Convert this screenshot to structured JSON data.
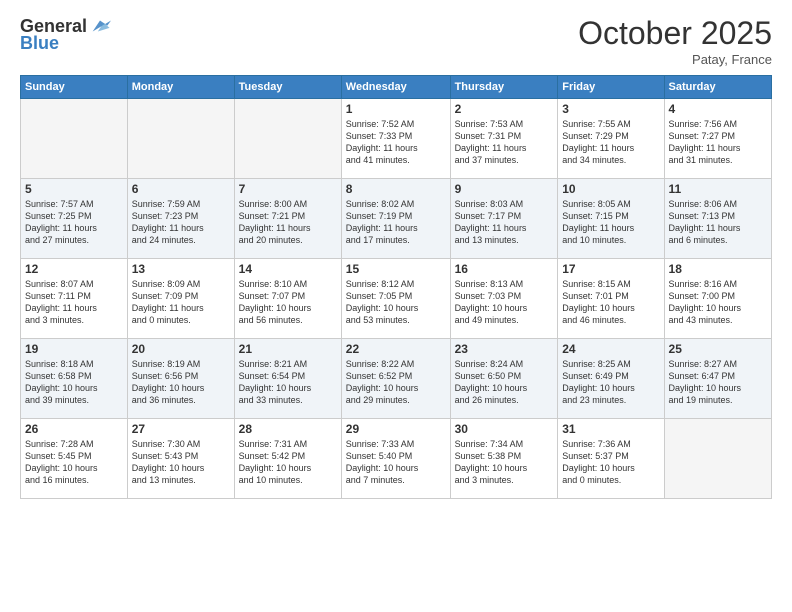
{
  "header": {
    "logo_line1": "General",
    "logo_line2": "Blue",
    "month_title": "October 2025",
    "location": "Patay, France"
  },
  "weekdays": [
    "Sunday",
    "Monday",
    "Tuesday",
    "Wednesday",
    "Thursday",
    "Friday",
    "Saturday"
  ],
  "weeks": [
    [
      {
        "day": "",
        "info": ""
      },
      {
        "day": "",
        "info": ""
      },
      {
        "day": "",
        "info": ""
      },
      {
        "day": "1",
        "info": "Sunrise: 7:52 AM\nSunset: 7:33 PM\nDaylight: 11 hours\nand 41 minutes."
      },
      {
        "day": "2",
        "info": "Sunrise: 7:53 AM\nSunset: 7:31 PM\nDaylight: 11 hours\nand 37 minutes."
      },
      {
        "day": "3",
        "info": "Sunrise: 7:55 AM\nSunset: 7:29 PM\nDaylight: 11 hours\nand 34 minutes."
      },
      {
        "day": "4",
        "info": "Sunrise: 7:56 AM\nSunset: 7:27 PM\nDaylight: 11 hours\nand 31 minutes."
      }
    ],
    [
      {
        "day": "5",
        "info": "Sunrise: 7:57 AM\nSunset: 7:25 PM\nDaylight: 11 hours\nand 27 minutes."
      },
      {
        "day": "6",
        "info": "Sunrise: 7:59 AM\nSunset: 7:23 PM\nDaylight: 11 hours\nand 24 minutes."
      },
      {
        "day": "7",
        "info": "Sunrise: 8:00 AM\nSunset: 7:21 PM\nDaylight: 11 hours\nand 20 minutes."
      },
      {
        "day": "8",
        "info": "Sunrise: 8:02 AM\nSunset: 7:19 PM\nDaylight: 11 hours\nand 17 minutes."
      },
      {
        "day": "9",
        "info": "Sunrise: 8:03 AM\nSunset: 7:17 PM\nDaylight: 11 hours\nand 13 minutes."
      },
      {
        "day": "10",
        "info": "Sunrise: 8:05 AM\nSunset: 7:15 PM\nDaylight: 11 hours\nand 10 minutes."
      },
      {
        "day": "11",
        "info": "Sunrise: 8:06 AM\nSunset: 7:13 PM\nDaylight: 11 hours\nand 6 minutes."
      }
    ],
    [
      {
        "day": "12",
        "info": "Sunrise: 8:07 AM\nSunset: 7:11 PM\nDaylight: 11 hours\nand 3 minutes."
      },
      {
        "day": "13",
        "info": "Sunrise: 8:09 AM\nSunset: 7:09 PM\nDaylight: 11 hours\nand 0 minutes."
      },
      {
        "day": "14",
        "info": "Sunrise: 8:10 AM\nSunset: 7:07 PM\nDaylight: 10 hours\nand 56 minutes."
      },
      {
        "day": "15",
        "info": "Sunrise: 8:12 AM\nSunset: 7:05 PM\nDaylight: 10 hours\nand 53 minutes."
      },
      {
        "day": "16",
        "info": "Sunrise: 8:13 AM\nSunset: 7:03 PM\nDaylight: 10 hours\nand 49 minutes."
      },
      {
        "day": "17",
        "info": "Sunrise: 8:15 AM\nSunset: 7:01 PM\nDaylight: 10 hours\nand 46 minutes."
      },
      {
        "day": "18",
        "info": "Sunrise: 8:16 AM\nSunset: 7:00 PM\nDaylight: 10 hours\nand 43 minutes."
      }
    ],
    [
      {
        "day": "19",
        "info": "Sunrise: 8:18 AM\nSunset: 6:58 PM\nDaylight: 10 hours\nand 39 minutes."
      },
      {
        "day": "20",
        "info": "Sunrise: 8:19 AM\nSunset: 6:56 PM\nDaylight: 10 hours\nand 36 minutes."
      },
      {
        "day": "21",
        "info": "Sunrise: 8:21 AM\nSunset: 6:54 PM\nDaylight: 10 hours\nand 33 minutes."
      },
      {
        "day": "22",
        "info": "Sunrise: 8:22 AM\nSunset: 6:52 PM\nDaylight: 10 hours\nand 29 minutes."
      },
      {
        "day": "23",
        "info": "Sunrise: 8:24 AM\nSunset: 6:50 PM\nDaylight: 10 hours\nand 26 minutes."
      },
      {
        "day": "24",
        "info": "Sunrise: 8:25 AM\nSunset: 6:49 PM\nDaylight: 10 hours\nand 23 minutes."
      },
      {
        "day": "25",
        "info": "Sunrise: 8:27 AM\nSunset: 6:47 PM\nDaylight: 10 hours\nand 19 minutes."
      }
    ],
    [
      {
        "day": "26",
        "info": "Sunrise: 7:28 AM\nSunset: 5:45 PM\nDaylight: 10 hours\nand 16 minutes."
      },
      {
        "day": "27",
        "info": "Sunrise: 7:30 AM\nSunset: 5:43 PM\nDaylight: 10 hours\nand 13 minutes."
      },
      {
        "day": "28",
        "info": "Sunrise: 7:31 AM\nSunset: 5:42 PM\nDaylight: 10 hours\nand 10 minutes."
      },
      {
        "day": "29",
        "info": "Sunrise: 7:33 AM\nSunset: 5:40 PM\nDaylight: 10 hours\nand 7 minutes."
      },
      {
        "day": "30",
        "info": "Sunrise: 7:34 AM\nSunset: 5:38 PM\nDaylight: 10 hours\nand 3 minutes."
      },
      {
        "day": "31",
        "info": "Sunrise: 7:36 AM\nSunset: 5:37 PM\nDaylight: 10 hours\nand 0 minutes."
      },
      {
        "day": "",
        "info": ""
      }
    ]
  ]
}
